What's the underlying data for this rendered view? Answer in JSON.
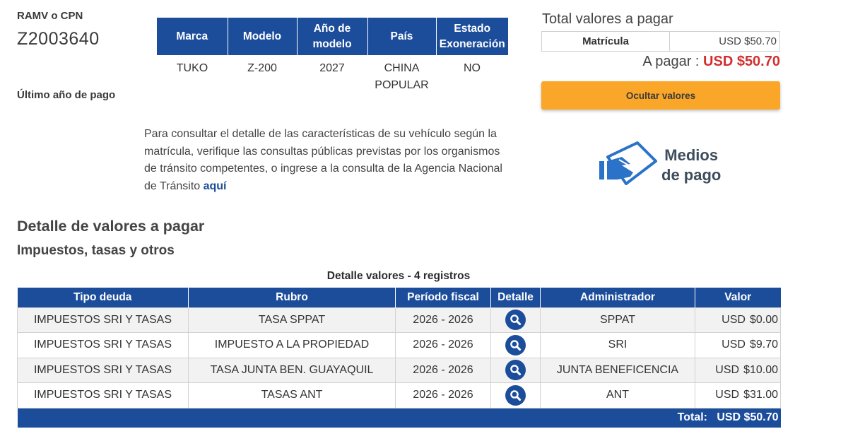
{
  "vehicle": {
    "ramv_label": "RAMV o CPN",
    "ramv_value": "Z2003640",
    "last_payment_label": "Último año de pago",
    "headers": [
      "Marca",
      "Modelo",
      "Año de modelo",
      "País",
      "Estado Exoneración"
    ],
    "values": [
      "TUKO",
      "Z-200",
      "2027",
      "CHINA POPULAR",
      "NO"
    ]
  },
  "info": {
    "text": "Para consultar el detalle de las características de su vehículo según la matrícula, verifique las consultas públicas previstas por los organismos de tránsito competentes, o ingrese a la consulta de la Agencia Nacional de Tránsito ",
    "link": "aquí"
  },
  "totals": {
    "title": "Total valores a pagar",
    "item_name": "Matrícula",
    "item_amount": "USD $50.70",
    "pay_label": "A pagar : ",
    "pay_amount": "USD $50.70",
    "hide_button": "Ocultar valores"
  },
  "payment_methods": {
    "line1": "Medios",
    "line2": "de pago",
    "icon": "hand-card-icon"
  },
  "detail": {
    "title": "Detalle de valores a pagar",
    "subtitle": "Impuestos, tasas y otros",
    "caption": "Detalle valores - 4 registros",
    "columns": [
      "Tipo deuda",
      "Rubro",
      "Período fiscal",
      "Detalle",
      "Administrador",
      "Valor"
    ],
    "rows": [
      {
        "tipo": "IMPUESTOS SRI Y TASAS",
        "rubro": "TASA SPPAT",
        "periodo": "2026 - 2026",
        "admin": "SPPAT",
        "currency": "USD",
        "valor": "$0.00"
      },
      {
        "tipo": "IMPUESTOS SRI Y TASAS",
        "rubro": "IMPUESTO A LA PROPIEDAD",
        "periodo": "2026 - 2026",
        "admin": "SRI",
        "currency": "USD",
        "valor": "$9.70"
      },
      {
        "tipo": "IMPUESTOS SRI Y TASAS",
        "rubro": "TASA JUNTA BEN. GUAYAQUIL",
        "periodo": "2026 - 2026",
        "admin": "JUNTA BENEFICENCIA",
        "currency": "USD",
        "valor": "$10.00"
      },
      {
        "tipo": "IMPUESTOS SRI Y TASAS",
        "rubro": "TASAS ANT",
        "periodo": "2026 - 2026",
        "admin": "ANT",
        "currency": "USD",
        "valor": "$31.00"
      }
    ],
    "total_label": "Total:",
    "total_value": "USD $50.70",
    "detail_icon": "search-icon"
  },
  "colors": {
    "primary": "#1c4d9b",
    "accent": "#faa628",
    "amount_red": "#d32f2f"
  }
}
